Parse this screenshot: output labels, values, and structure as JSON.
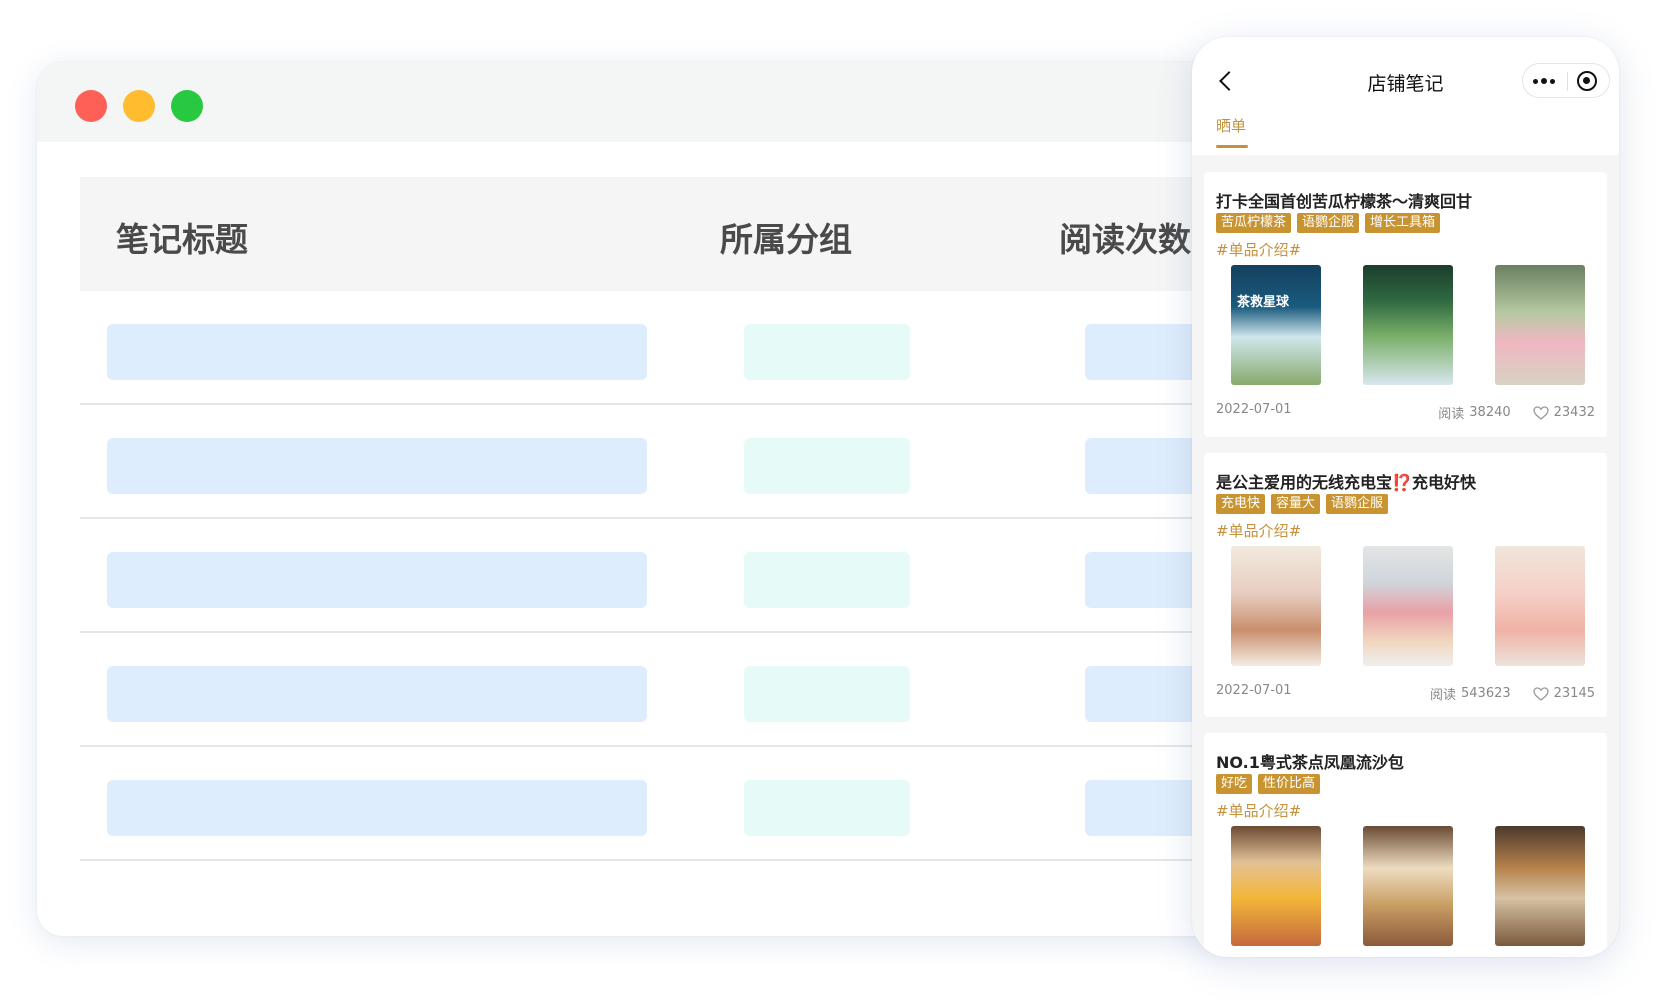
{
  "table": {
    "headers": [
      "笔记标题",
      "所属分组",
      "阅读次数"
    ],
    "row_count": 5
  },
  "phone": {
    "nav_title": "店铺笔记",
    "tab_label": "晒单",
    "accent_color": "#c4913d",
    "tag_color": "#c89432",
    "notes": [
      {
        "title": "打卡全国首创苦瓜柠檬茶～清爽回甘",
        "tags": [
          "苦瓜柠檬茶",
          "语鹦企服",
          "增长工具箱"
        ],
        "topic": "#单品介绍#",
        "image_text": "茶救星球",
        "date": "2022-07-01",
        "reads_label": "阅读",
        "reads": "38240",
        "likes": "23432"
      },
      {
        "title_before": "是公主爱用的无线充电宝",
        "title_emoji": "⁉️",
        "title_after": "充电好快",
        "tags": [
          "充电快",
          "容量大",
          "语鹦企服"
        ],
        "topic": "#单品介绍#",
        "date": "2022-07-01",
        "reads_label": "阅读",
        "reads": "543623",
        "likes": "23145"
      },
      {
        "title": "NO.1粤式茶点凤凰流沙包",
        "tags": [
          "好吃",
          "性价比高"
        ],
        "topic": "#单品介绍#"
      }
    ]
  },
  "icons": {
    "back": "chevron-left-icon",
    "more": "more-dots-icon",
    "close": "target-circle-icon",
    "like": "heart-outline-icon"
  }
}
